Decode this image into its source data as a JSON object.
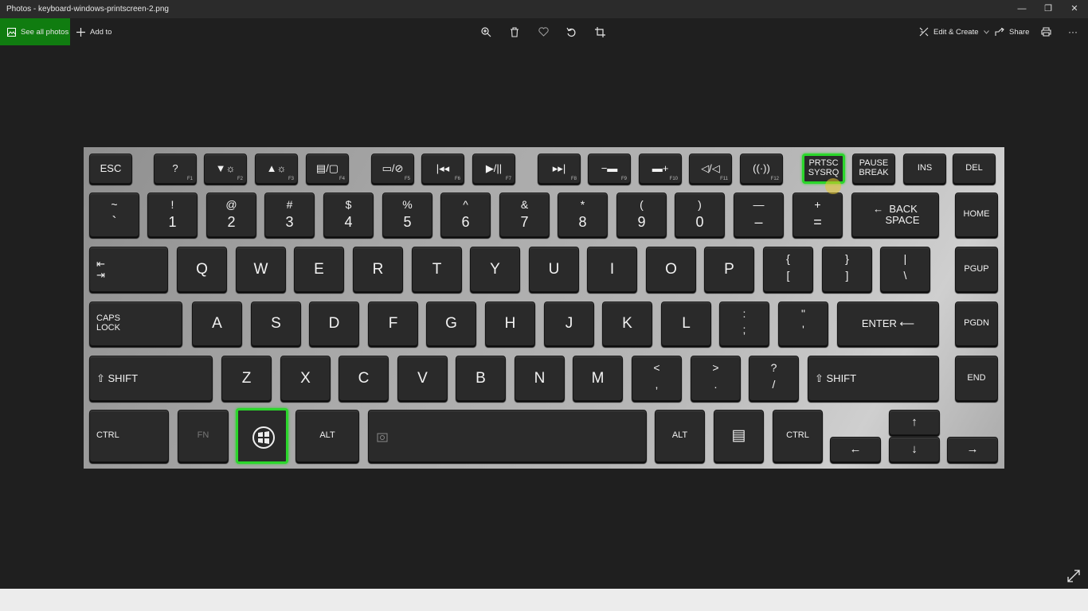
{
  "window": {
    "title": "Photos - keyboard-windows-printscreen-2.png",
    "minimize": "—",
    "restore": "❐",
    "close": "✕"
  },
  "toolbar": {
    "see_all_photos": "See all photos",
    "add_to": "Add to",
    "edit_create": "Edit & Create",
    "share": "Share",
    "more": "···",
    "icons": [
      "zoom-icon",
      "delete-icon",
      "favorite-icon",
      "rotate-icon",
      "crop-icon",
      "print-icon"
    ]
  },
  "keyboard": {
    "highlight_color": "#2bd62b",
    "row1": [
      "ESC",
      "?",
      "▼☼",
      "▲☼",
      "▤/▢",
      "▭/⊘",
      "|◂◂",
      "▶/||",
      "▸▸|",
      "−▬",
      "▬+",
      "◁/◁",
      "((·))",
      "PRTSC\nSYSRQ",
      "PAUSE\nBREAK",
      "INS",
      "DEL"
    ],
    "row1_sub": [
      "",
      "F1",
      "F2",
      "F3",
      "F4",
      "F5",
      "F6",
      "F7",
      "F8",
      "F9",
      "F10",
      "F11",
      "F12",
      "",
      "",
      "",
      ""
    ],
    "row2": [
      [
        "~",
        "`"
      ],
      [
        "!",
        "1"
      ],
      [
        "@",
        "2"
      ],
      [
        "#",
        "3"
      ],
      [
        "$",
        "4"
      ],
      [
        "%",
        "5"
      ],
      [
        "^",
        "6"
      ],
      [
        "&",
        "7"
      ],
      [
        "*",
        "8"
      ],
      [
        "(",
        "9"
      ],
      [
        ")",
        "0"
      ],
      [
        "—",
        "–"
      ],
      [
        "+",
        "="
      ]
    ],
    "backspace": "←  BACK\n     SPACE",
    "home": "HOME",
    "tab": "⇤\n⇥",
    "row3": [
      "Q",
      "W",
      "E",
      "R",
      "T",
      "Y",
      "U",
      "I",
      "O",
      "P"
    ],
    "row3_brackets": [
      [
        "{",
        "["
      ],
      [
        "}",
        "]"
      ],
      [
        "|",
        "\\"
      ]
    ],
    "pgup": "PGUP",
    "caps": "CAPS\nLOCK",
    "row4": [
      "A",
      "S",
      "D",
      "F",
      "G",
      "H",
      "J",
      "K",
      "L"
    ],
    "row4_punct": [
      [
        ":",
        ";"
      ],
      [
        "\"",
        "'"
      ]
    ],
    "enter": "ENTER ⟵",
    "pgdn": "PGDN",
    "lshift": "⇧ SHIFT",
    "row5": [
      "Z",
      "X",
      "C",
      "V",
      "B",
      "N",
      "M"
    ],
    "row5_punct": [
      [
        "<",
        ","
      ],
      [
        ">",
        "."
      ],
      [
        "?",
        "/"
      ]
    ],
    "rshift": "⇧ SHIFT",
    "end": "END",
    "ctrl": "CTRL",
    "fn": "FN",
    "alt": "ALT",
    "menu": "▤",
    "rctrl": "CTRL",
    "arrow_up": "↑",
    "arrow_left": "←",
    "arrow_down": "↓",
    "arrow_right": "→"
  }
}
